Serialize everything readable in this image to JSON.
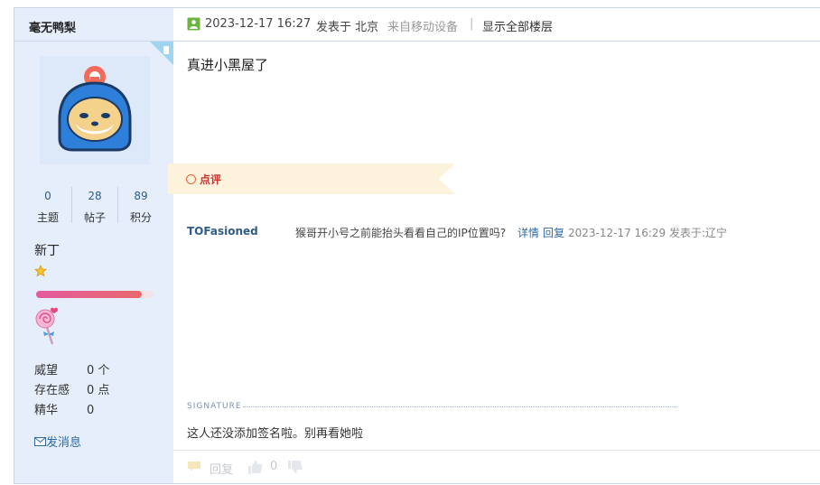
{
  "author": {
    "name": "毫无鸭梨",
    "stats": [
      {
        "value": "0",
        "label": "主题"
      },
      {
        "value": "28",
        "label": "帖子"
      },
      {
        "value": "89",
        "label": "积分"
      }
    ],
    "rank": "新丁",
    "progress": 0.9,
    "fields": [
      {
        "key": "威望",
        "value": "0 个"
      },
      {
        "key": "存在感",
        "value": "0 点"
      },
      {
        "key": "精华",
        "value": "0"
      }
    ],
    "send_message": "发消息"
  },
  "post": {
    "timestamp": "2023-12-17 16:27",
    "posted_in": "发表于 北京",
    "device": "来自移动设备",
    "divider": "|",
    "show_all": "显示全部楼层",
    "content": "真进小黑屋了"
  },
  "rating": {
    "label": "点评",
    "comment": {
      "user": "TOFasioned",
      "text": "猴哥开小号之前能抬头看看自己的IP位置吗?",
      "detail": "详情",
      "reply": "回复",
      "time": "2023-12-17 16:29 发表于:辽宁"
    }
  },
  "signature": {
    "label": "SIGNATURE",
    "text": "这人还没添加签名啦。别再看她啦"
  },
  "actions": {
    "reply": "回复",
    "like_count": "0"
  },
  "colors": {
    "accent": "#2f6aa7",
    "ribbon": "#fdf2dc",
    "rate_red": "#cc3333"
  }
}
